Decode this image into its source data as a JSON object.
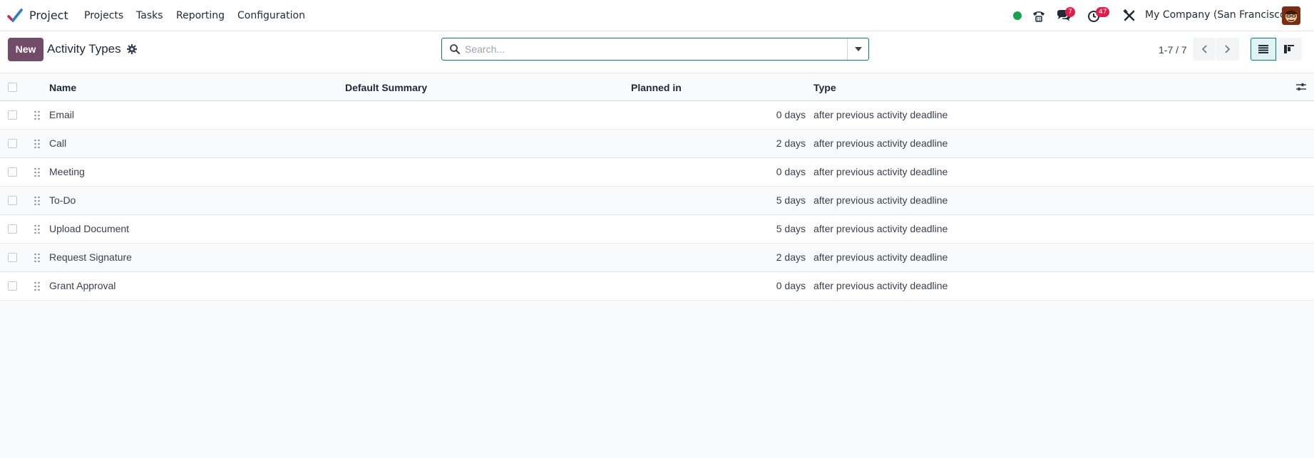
{
  "app": {
    "name": "Project"
  },
  "menu": [
    "Projects",
    "Tasks",
    "Reporting",
    "Configuration"
  ],
  "systray": {
    "messages_badge": "7",
    "activities_badge": "47",
    "company": "My Company (San Francisco)"
  },
  "control": {
    "new_label": "New",
    "breadcrumb": "Activity Types",
    "search_placeholder": "Search...",
    "pager": "1-7 / 7"
  },
  "table": {
    "headers": [
      "Name",
      "Default Summary",
      "Planned in",
      "Type"
    ],
    "rows": [
      {
        "name": "Email",
        "summary": "",
        "planned": "0 days",
        "type": "after previous activity deadline"
      },
      {
        "name": "Call",
        "summary": "",
        "planned": "2 days",
        "type": "after previous activity deadline"
      },
      {
        "name": "Meeting",
        "summary": "",
        "planned": "0 days",
        "type": "after previous activity deadline"
      },
      {
        "name": "To-Do",
        "summary": "",
        "planned": "5 days",
        "type": "after previous activity deadline"
      },
      {
        "name": "Upload Document",
        "summary": "",
        "planned": "5 days",
        "type": "after previous activity deadline"
      },
      {
        "name": "Request Signature",
        "summary": "",
        "planned": "2 days",
        "type": "after previous activity deadline"
      },
      {
        "name": "Grant Approval",
        "summary": "",
        "planned": "0 days",
        "type": "after previous activity deadline"
      }
    ]
  },
  "colors": {
    "brand": "#714b67",
    "accent": "#017e84",
    "status_online": "#16a34a",
    "badge": "#e11d48"
  },
  "icons": {
    "logo": "project-checkmark-icon",
    "voip": "phone-icon",
    "messages": "chat-icon",
    "activities": "clock-icon",
    "debug": "tools-icon",
    "settings": "gear-icon",
    "search": "search-icon",
    "dropdown": "caret-down-icon",
    "prev": "chevron-left-icon",
    "next": "chevron-right-icon",
    "list_view": "list-view-icon",
    "kanban_view": "kanban-view-icon",
    "drag": "drag-handle-icon",
    "optional_columns": "sliders-icon"
  }
}
